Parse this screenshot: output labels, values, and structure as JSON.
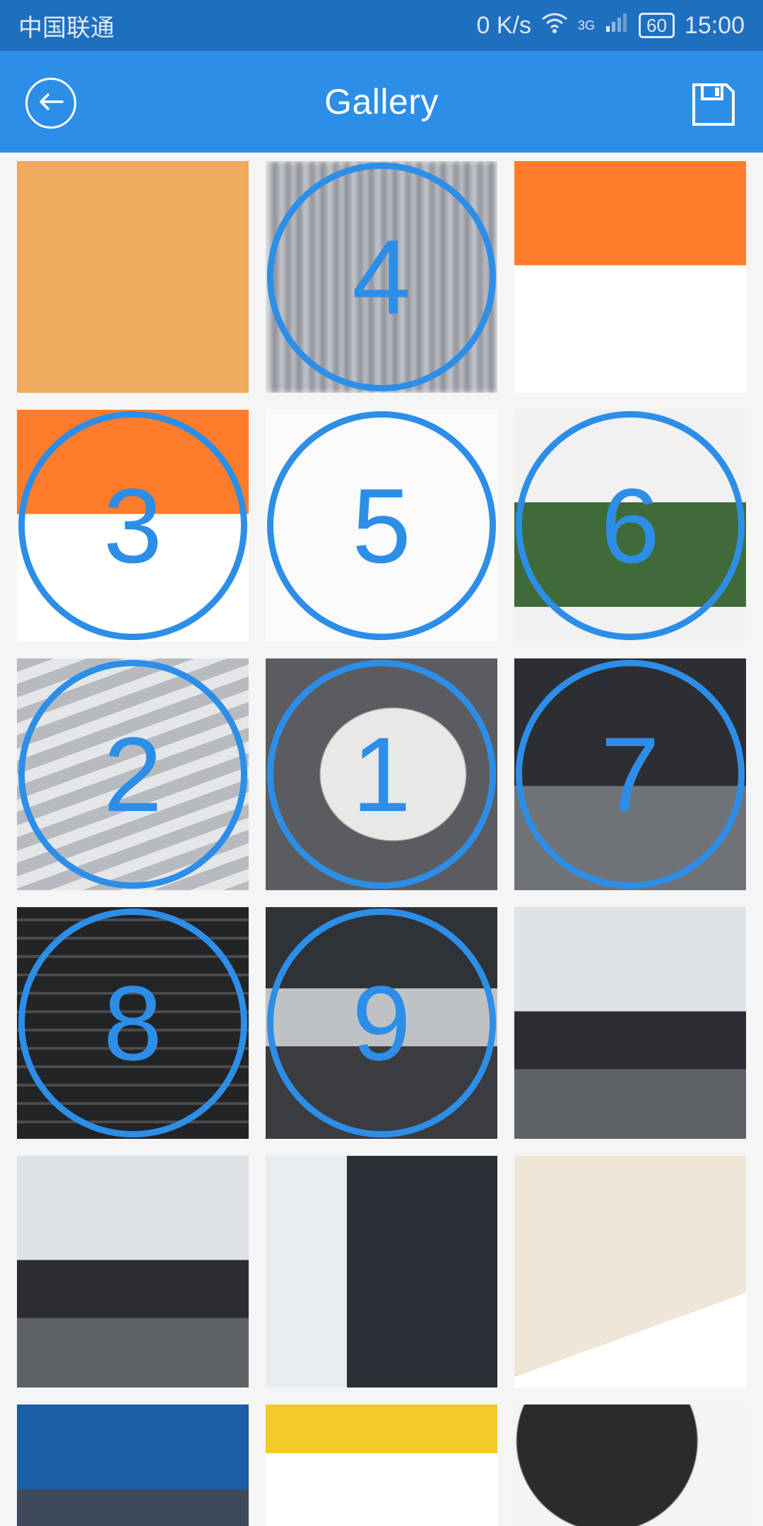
{
  "status_bar": {
    "carrier": "中国联通",
    "speed": "0 K/s",
    "network": "3G",
    "battery": "60",
    "time": "15:00"
  },
  "app_bar": {
    "title": "Gallery"
  },
  "grid": {
    "tiles": [
      {
        "label": ""
      },
      {
        "label": "4"
      },
      {
        "label": ""
      },
      {
        "label": "3"
      },
      {
        "label": "5"
      },
      {
        "label": "6"
      },
      {
        "label": "2"
      },
      {
        "label": "1"
      },
      {
        "label": "7"
      },
      {
        "label": "8"
      },
      {
        "label": "9"
      },
      {
        "label": ""
      },
      {
        "label": ""
      },
      {
        "label": ""
      },
      {
        "label": ""
      },
      {
        "label": ""
      },
      {
        "label": ""
      },
      {
        "label": ""
      }
    ]
  },
  "colors": {
    "status_bar": "#1f6fbf",
    "app_bar": "#2d8ee8",
    "selection_ring": "#2d8ee8"
  }
}
